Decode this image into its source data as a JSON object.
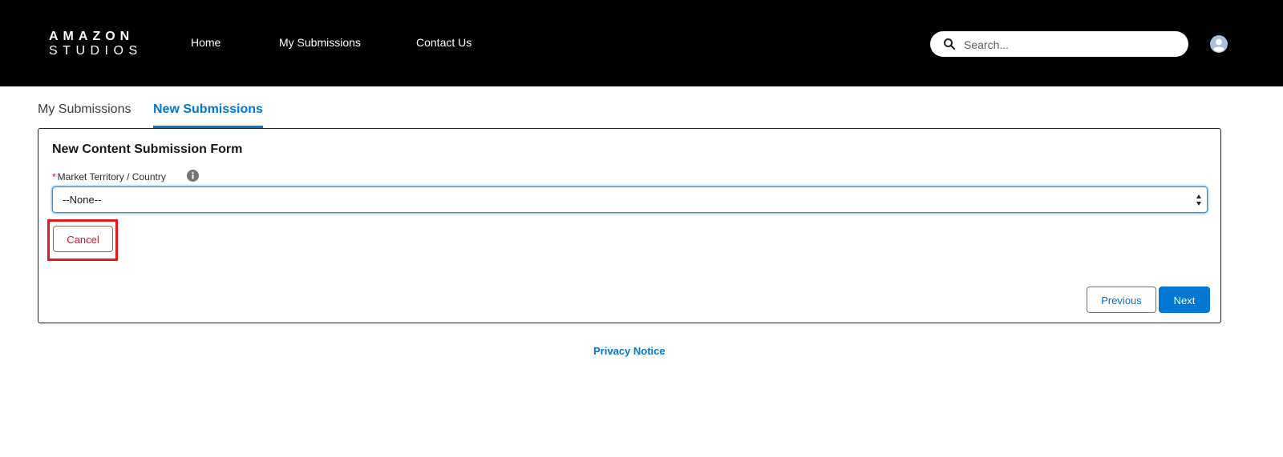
{
  "header": {
    "logo_line1": "AMAZON",
    "logo_line2": "STUDIOS",
    "nav": [
      {
        "label": "Home"
      },
      {
        "label": "My Submissions"
      },
      {
        "label": "Contact Us"
      }
    ],
    "search": {
      "placeholder": "Search...",
      "value": ""
    }
  },
  "tabs": [
    {
      "label": "My Submissions",
      "active": false
    },
    {
      "label": "New Submissions",
      "active": true
    }
  ],
  "form": {
    "title": "New Content Submission Form",
    "field": {
      "required_marker": "*",
      "label": "Market Territory / Country",
      "selected": "--None--"
    },
    "cancel_label": "Cancel",
    "previous_label": "Previous",
    "next_label": "Next"
  },
  "footer": {
    "privacy_label": "Privacy Notice"
  },
  "colors": {
    "brand": "#0176d3",
    "header_bg": "#000000",
    "highlight": "#e8151b",
    "cancel_text": "#d1132a"
  }
}
